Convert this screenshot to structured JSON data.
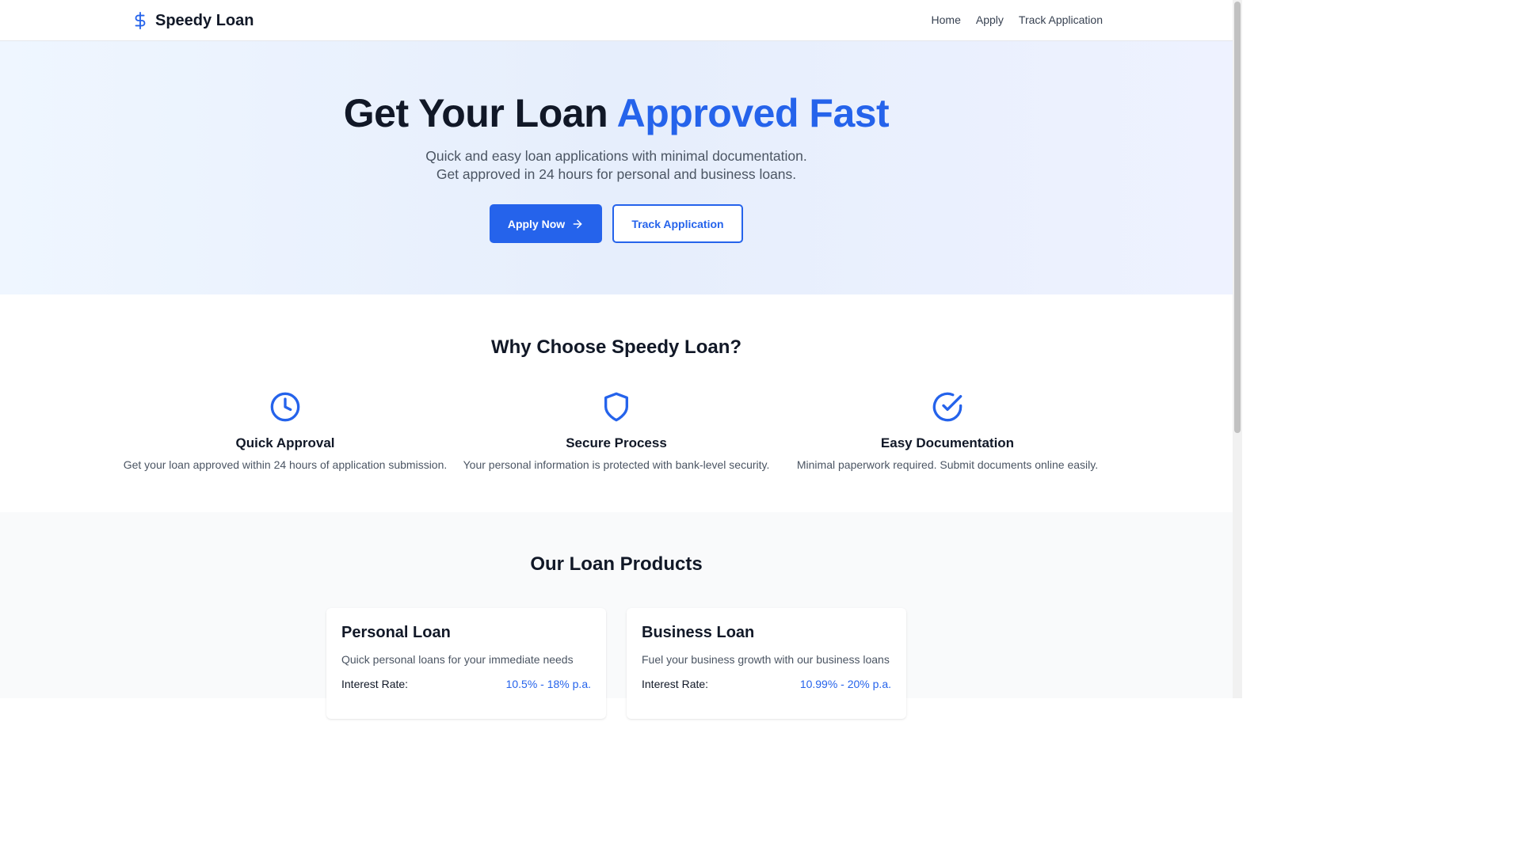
{
  "header": {
    "brand": "Speedy Loan",
    "nav": [
      "Home",
      "Apply",
      "Track Application"
    ]
  },
  "hero": {
    "title_main": "Get Your Loan ",
    "title_accent": "Approved Fast",
    "subtitle": "Quick and easy loan applications with minimal documentation. Get approved in 24 hours for personal and business loans.",
    "primary_button": "Apply Now",
    "secondary_button": "Track Application"
  },
  "features": {
    "title": "Why Choose Speedy Loan?",
    "items": [
      {
        "icon": "clock-icon",
        "title": "Quick Approval",
        "description": "Get your loan approved within 24 hours of application submission."
      },
      {
        "icon": "shield-icon",
        "title": "Secure Process",
        "description": "Your personal information is protected with bank-level security."
      },
      {
        "icon": "check-circle-icon",
        "title": "Easy Documentation",
        "description": "Minimal paperwork required. Submit documents online easily."
      }
    ]
  },
  "products": {
    "title": "Our Loan Products",
    "cards": [
      {
        "title": "Personal Loan",
        "description": "Quick personal loans for your immediate needs",
        "rate_label": "Interest Rate:",
        "rate_value": "10.5% - 18% p.a."
      },
      {
        "title": "Business Loan",
        "description": "Fuel your business growth with our business loans",
        "rate_label": "Interest Rate:",
        "rate_value": "10.99% - 20% p.a."
      }
    ]
  },
  "colors": {
    "accent": "#2563eb",
    "text": "#111827",
    "muted": "#4b5563"
  }
}
